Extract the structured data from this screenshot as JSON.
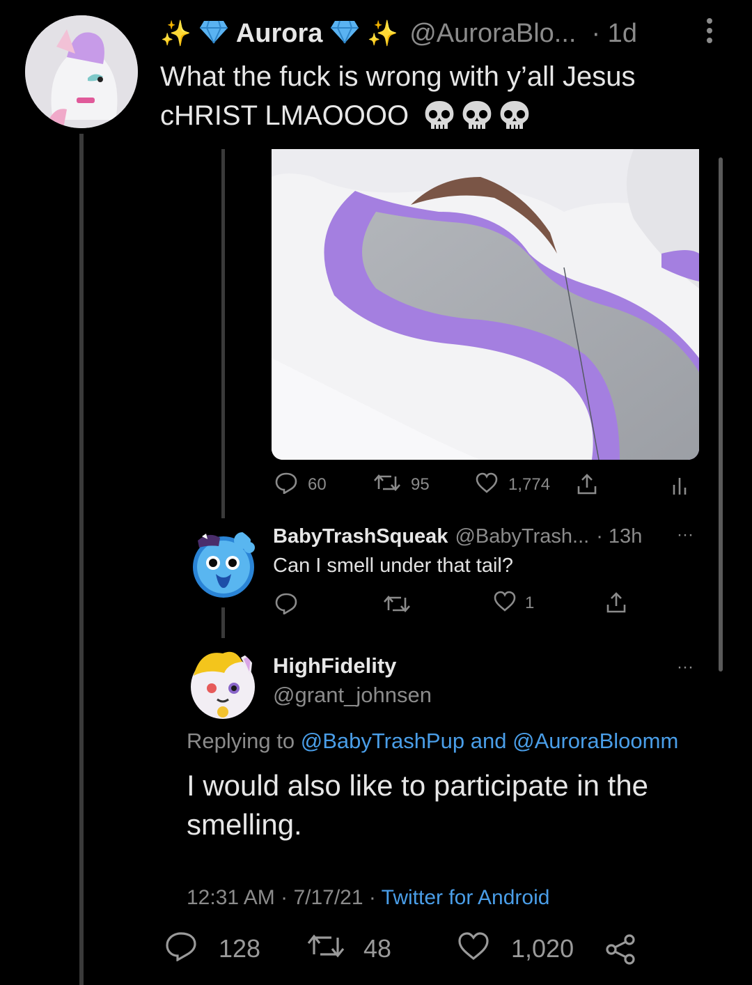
{
  "main_tweet": {
    "display_name": "Aurora",
    "handle": "@AuroraBlo...",
    "time": "· 1d",
    "text_line1": "What the fuck is wrong with y’all Jesus",
    "text_line2": "cHRIST LMAOOOO",
    "emoji_name": "skull-emoji",
    "stats": {
      "replies": "60",
      "retweets": "95",
      "likes": "1,774"
    }
  },
  "reply_1": {
    "display_name": "BabyTrashSqueak",
    "handle": "@BabyTrash...",
    "time": "· 13h",
    "more": "···",
    "text": "Can I smell under that tail?",
    "likes": "1"
  },
  "focused_tweet": {
    "display_name": "HighFidelity",
    "handle": "@grant_johnsen",
    "more": "···",
    "replying_prefix": "Replying to",
    "replying_user1": "@BabyTrashPup",
    "replying_and": "and",
    "replying_user2": "@AuroraBloomm",
    "text": "I would also like to participate in the smelling.",
    "time": "12:31 AM",
    "date": "7/17/21",
    "client": "Twitter for Android",
    "stats": {
      "replies": "128",
      "retweets": "48",
      "likes": "1,020"
    }
  },
  "colors": {
    "background": "#000000",
    "link": "#4a9ee8",
    "fur_purple": "#a47fe0",
    "fur_gray": "#a5a8ad"
  }
}
